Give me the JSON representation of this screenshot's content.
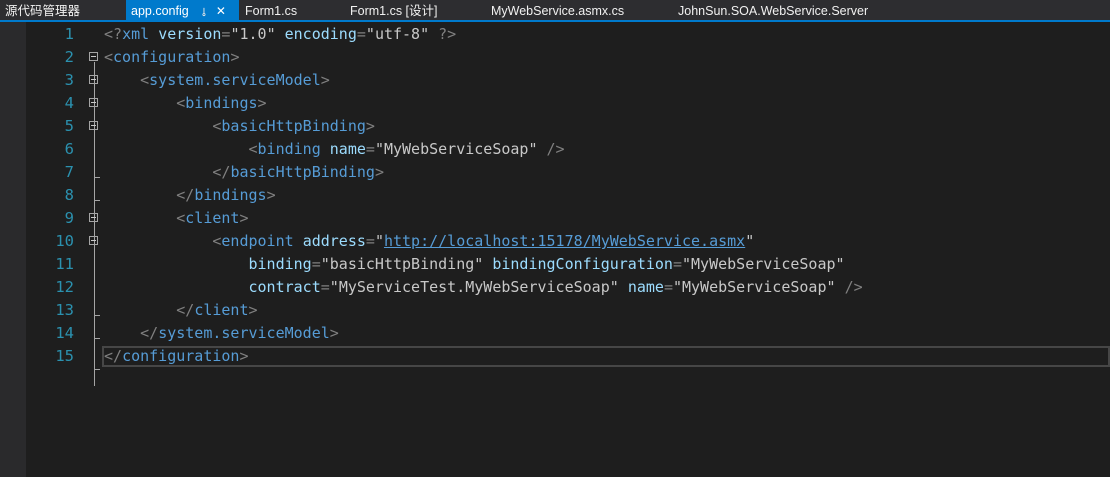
{
  "tabs": {
    "solution_explorer": "源代码管理器",
    "app_config": "app.config",
    "form1_cs": "Form1.cs",
    "form1_design": "Form1.cs [设计]",
    "webservice_asmx": "MyWebService.asmx.cs",
    "server_project": "JohnSun.SOA.WebService.Server"
  },
  "icons": {
    "pin": "pin-icon",
    "close": "close-icon",
    "fold": "collapse-minus-icon"
  },
  "colors": {
    "accent": "#007acc",
    "background": "#1e1e1e",
    "line_number": "#2b91af",
    "tag": "#569cd6",
    "attribute": "#9cdcfe",
    "delimiter": "#808080"
  },
  "editor": {
    "line_numbers": [
      "1",
      "2",
      "3",
      "4",
      "5",
      "6",
      "7",
      "8",
      "9",
      "10",
      "11",
      "12",
      "13",
      "14",
      "15"
    ],
    "code": {
      "l1": {
        "lt": "<?",
        "tag": "xml",
        "a1": "version",
        "v1": "1.0",
        "a2": "encoding",
        "v2": "utf-8",
        "end": "?>"
      },
      "l2": {
        "tag": "configuration"
      },
      "l3": {
        "tag": "system.serviceModel"
      },
      "l4": {
        "tag": "bindings"
      },
      "l5": {
        "tag": "basicHttpBinding"
      },
      "l6": {
        "tag": "binding",
        "a1": "name",
        "v1": "MyWebServiceSoap"
      },
      "l7": {
        "tag": "basicHttpBinding"
      },
      "l8": {
        "tag": "bindings"
      },
      "l9": {
        "tag": "client"
      },
      "l10": {
        "tag": "endpoint",
        "a1": "address",
        "v1": "http://localhost:15178/MyWebService.asmx"
      },
      "l11": {
        "a1": "binding",
        "v1": "basicHttpBinding",
        "a2": "bindingConfiguration",
        "v2": "MyWebServiceSoap"
      },
      "l12": {
        "a1": "contract",
        "v1": "MyServiceTest.MyWebServiceSoap",
        "a2": "name",
        "v2": "MyWebServiceSoap"
      },
      "l13": {
        "tag": "client"
      },
      "l14": {
        "tag": "system.serviceModel"
      },
      "l15": {
        "tag": "configuration"
      }
    }
  }
}
